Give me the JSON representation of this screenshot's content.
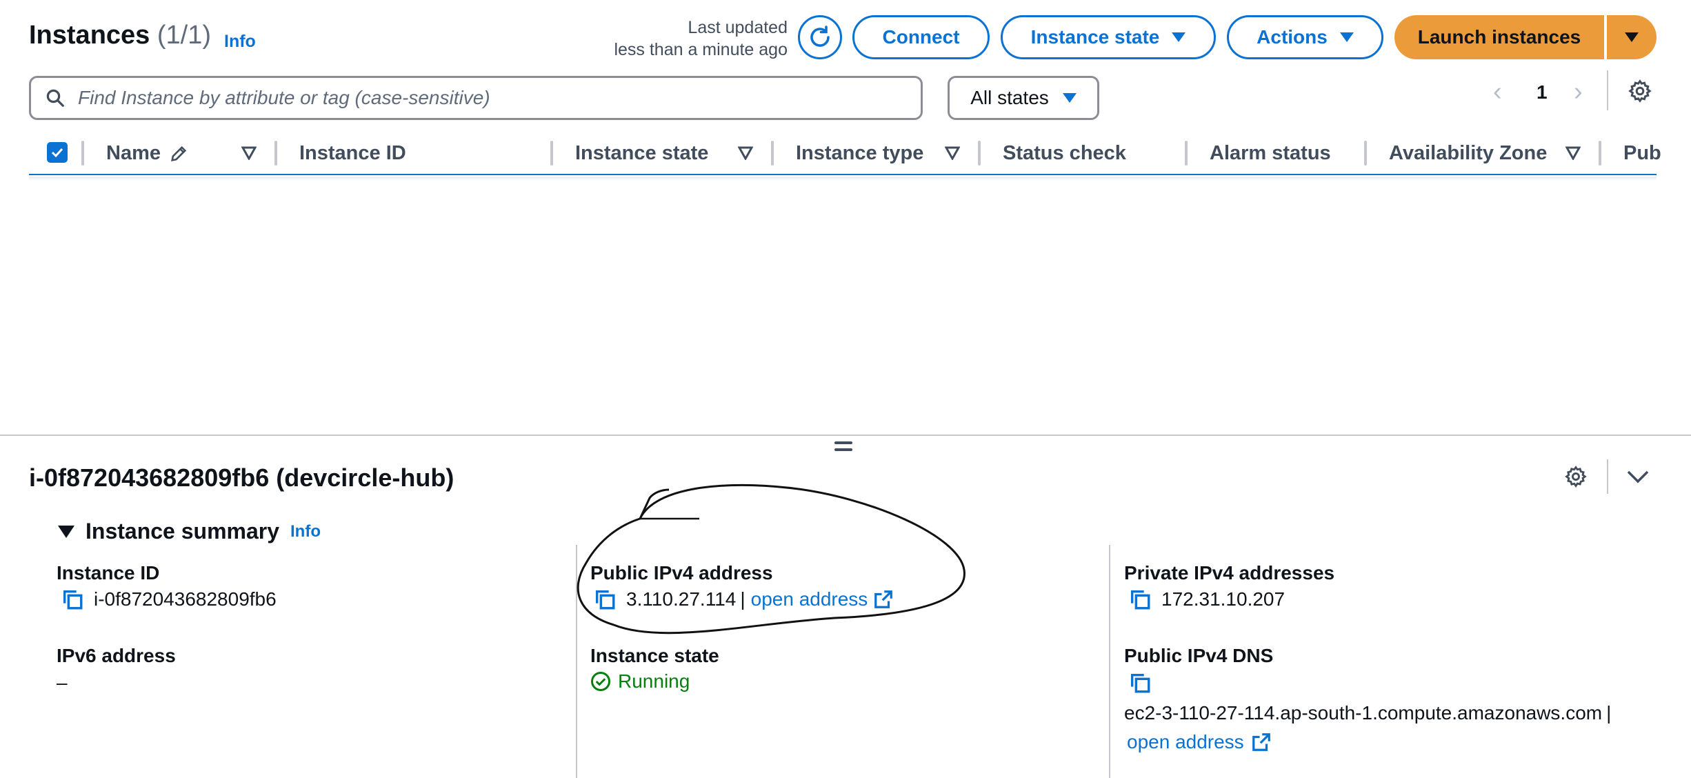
{
  "header": {
    "title": "Instances",
    "count": "(1/1)",
    "info": "Info",
    "last_updated_line1": "Last updated",
    "last_updated_line2": "less than a minute ago",
    "connect": "Connect",
    "instance_state": "Instance state",
    "actions": "Actions",
    "launch": "Launch instances"
  },
  "search": {
    "placeholder": "Find Instance by attribute or tag (case-sensitive)",
    "state_filter": "All states"
  },
  "pagination": {
    "page": "1"
  },
  "table": {
    "columns": [
      "Name",
      "Instance ID",
      "Instance state",
      "Instance type",
      "Status check",
      "Alarm status",
      "Availability Zone",
      "Pub"
    ]
  },
  "detail": {
    "title": "i-0f872043682809fb6 (devcircle-hub)",
    "summary_title": "Instance summary",
    "summary_info": "Info",
    "instance_id_label": "Instance ID",
    "instance_id": "i-0f872043682809fb6",
    "ipv6_label": "IPv6 address",
    "ipv6": "–",
    "public_ipv4_label": "Public IPv4 address",
    "public_ipv4": "3.110.27.114",
    "public_ipv4_sep": "|",
    "open_address": "open address",
    "instance_state_label": "Instance state",
    "instance_state": "Running",
    "private_ipv4_label": "Private IPv4 addresses",
    "private_ipv4": "172.31.10.207",
    "public_dns_label": "Public IPv4 DNS",
    "public_dns": "ec2-3-110-27-114.ap-south-1.compute.amazonaws.com",
    "public_dns_sep": "|",
    "dns_open_address": "open address"
  },
  "colors": {
    "accent": "#0972d3",
    "launch": "#ec9b3a",
    "running": "#037f0c"
  },
  "icons": [
    "refresh-icon",
    "search-icon",
    "caret-down-icon",
    "gear-icon",
    "copy-icon",
    "external-link-icon",
    "check-circle-icon",
    "chevron-down-icon",
    "pencil-icon",
    "sort-icon"
  ]
}
